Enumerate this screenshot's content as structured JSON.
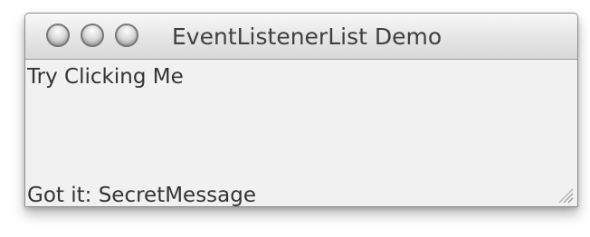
{
  "window": {
    "title": "EventListenerList Demo"
  },
  "main": {
    "click_label": "Try Clicking Me",
    "status": "Got it: SecretMessage"
  },
  "icons": {
    "window_buttons": [
      "window-close-icon",
      "window-minimize-icon",
      "window-zoom-icon"
    ],
    "resize": "resize-grip-icon"
  },
  "colors": {
    "window_background": "#f1f1f1",
    "titlebar_top": "#f8f8f8",
    "titlebar_bottom": "#d8d8d8",
    "text": "#333333",
    "title_text": "#3f3f3f",
    "window_button": "#dddddd"
  }
}
